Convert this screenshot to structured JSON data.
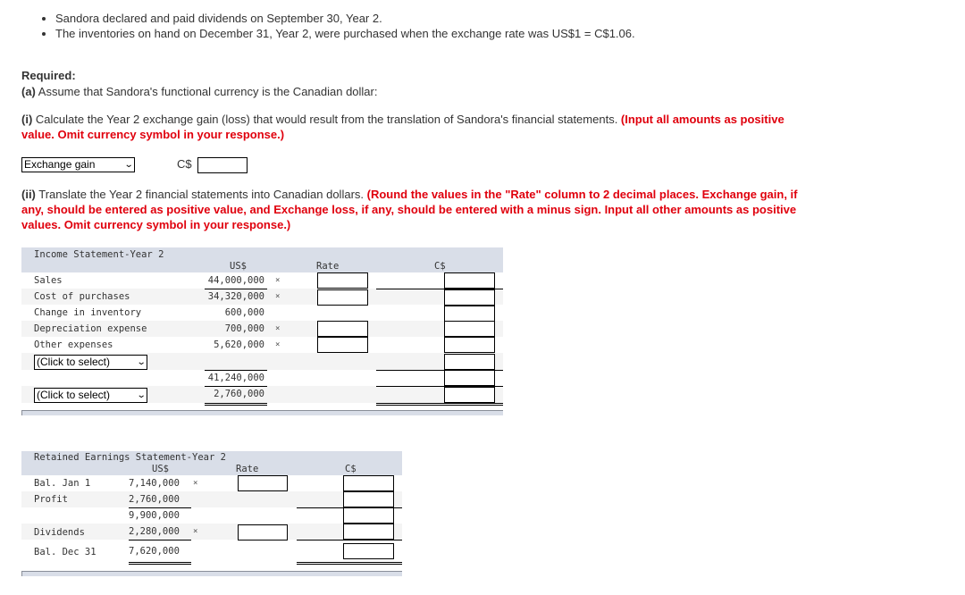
{
  "intro": {
    "bullets": [
      "Sandora declared and paid dividends on September 30, Year 2.",
      "The inventories on hand on December 31, Year 2, were purchased when the exchange rate was US$1 = C$1.06."
    ]
  },
  "required": {
    "heading": "Required:",
    "part_a_label": "(a)",
    "part_a_text": " Assume that Sandora's functional currency is the Canadian dollar:",
    "part_i_label": "(i)",
    "part_i_text": " Calculate the Year 2 exchange gain (loss) that would result from the translation of Sandora's financial statements. ",
    "part_i_instruction": "(Input all amounts as positive value. Omit currency symbol in your response.)",
    "exchange_select_value": "Exchange gain",
    "currency_prefix": "C$",
    "exchange_amount_value": "",
    "part_ii_label": "(ii)",
    "part_ii_text": " Translate the Year 2 financial statements into Canadian dollars. ",
    "part_ii_instruction": "(Round the values in the \"Rate\" column to 2 decimal places. Exchange gain, if any, should be entered as positive value, and Exchange loss, if any, should be entered with a minus sign. Input all other amounts as positive values. Omit currency symbol in your response.)"
  },
  "income_statement": {
    "title": "Income Statement-Year 2",
    "col_us": "US$",
    "col_rate": "Rate",
    "col_cd": "C$",
    "rows": [
      {
        "label": "Sales",
        "us": "44,000,000",
        "mark": "×",
        "has_rate": true
      },
      {
        "label": "Cost of purchases",
        "us": "34,320,000",
        "mark": "×",
        "has_rate": true
      },
      {
        "label": "Change in inventory",
        "us": "600,000",
        "mark": "",
        "has_rate": false
      },
      {
        "label": "Depreciation expense",
        "us": "700,000",
        "mark": "×",
        "has_rate": true
      },
      {
        "label": "Other expenses",
        "us": "5,620,000",
        "mark": "×",
        "has_rate": true
      },
      {
        "label_select": "(Click to select)",
        "us": "",
        "mark": "",
        "has_rate": false
      },
      {
        "label": "",
        "us": "41,240,000",
        "mark": "",
        "has_rate": false
      },
      {
        "label_select": "(Click to select)",
        "us": "2,760,000",
        "mark": "",
        "has_rate": false
      }
    ]
  },
  "retained_earnings": {
    "title": "Retained Earnings Statement-Year 2",
    "col_us": "US$",
    "col_rate": "Rate",
    "col_cd": "C$",
    "rows": [
      {
        "label": "Bal. Jan 1",
        "us": "7,140,000",
        "mark": "×",
        "has_rate": true
      },
      {
        "label": "Profit",
        "us": "2,760,000",
        "mark": "",
        "has_rate": false
      },
      {
        "label": "",
        "us": "9,900,000",
        "mark": "",
        "has_rate": false
      },
      {
        "label": "Dividends",
        "us": "2,280,000",
        "mark": "×",
        "has_rate": true
      },
      {
        "label": "Bal. Dec 31",
        "us": "7,620,000",
        "mark": "",
        "has_rate": false
      }
    ]
  }
}
